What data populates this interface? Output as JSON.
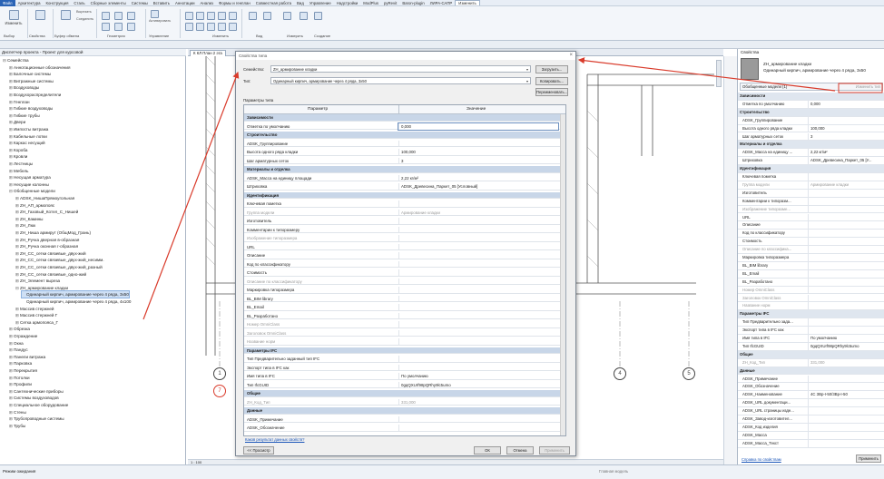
{
  "menu": [
    "Файл",
    "Архитектура",
    "Конструкция",
    "Сталь",
    "Сборные элементы",
    "Системы",
    "Вставить",
    "Аннотации",
    "Анализ",
    "Формы и генплан",
    "Совместная работа",
    "Вид",
    "Управление",
    "Надстройки",
    "ModPlus",
    "pyRevit",
    "Baron-plugin",
    "ЛИРА-САПР",
    "Изменить"
  ],
  "ribbon": {
    "modify": "Изменить",
    "select": "Выбор",
    "properties": "Свойства",
    "clipboard": "Буфер обмена",
    "cut": "Вырезать",
    "join": "Соединить",
    "geometry": "Геометрия",
    "control": "Управление",
    "edit": "Изменить",
    "view": "Вид",
    "measure": "Измерить",
    "create": "Создание",
    "activate": "Активировать"
  },
  "browser": {
    "title": "Диспетчер проекта - Проект для курсовой",
    "items": [
      {
        "t": "Семейства",
        "d": 0,
        "g": "⊟"
      },
      {
        "t": "Аннотационные обозначения",
        "d": 1,
        "g": "⊞"
      },
      {
        "t": "Балочные системы",
        "d": 1,
        "g": "⊞"
      },
      {
        "t": "Витражные системы",
        "d": 1,
        "g": "⊞"
      },
      {
        "t": "Воздуховоды",
        "d": 1,
        "g": "⊞"
      },
      {
        "t": "Воздухораспределители",
        "d": 1,
        "g": "⊞"
      },
      {
        "t": "Генплан",
        "d": 1,
        "g": "⊞"
      },
      {
        "t": "Гибкие воздуховоды",
        "d": 1,
        "g": "⊞"
      },
      {
        "t": "Гибкие трубы",
        "d": 1,
        "g": "⊞"
      },
      {
        "t": "Двери",
        "d": 1,
        "g": "⊞"
      },
      {
        "t": "Импосты витража",
        "d": 1,
        "g": "⊞"
      },
      {
        "t": "Кабельные лотки",
        "d": 1,
        "g": "⊞"
      },
      {
        "t": "Каркас несущий",
        "d": 1,
        "g": "⊞"
      },
      {
        "t": "Короба",
        "d": 1,
        "g": "⊞"
      },
      {
        "t": "Кровли",
        "d": 1,
        "g": "⊞"
      },
      {
        "t": "Лестницы",
        "d": 1,
        "g": "⊞"
      },
      {
        "t": "Мебель",
        "d": 1,
        "g": "⊞"
      },
      {
        "t": "Несущая арматура",
        "d": 1,
        "g": "⊞"
      },
      {
        "t": "Несущие колонны",
        "d": 1,
        "g": "⊞"
      },
      {
        "t": "Обобщенные модели",
        "d": 1,
        "g": "⊟"
      },
      {
        "t": "ADSK_НишаПрямоугольная",
        "d": 2,
        "g": "⊞"
      },
      {
        "t": "ZH_АП_армопояс",
        "d": 2,
        "g": "⊞"
      },
      {
        "t": "ZH_Газовый_Котел_С_Нишей",
        "d": 2,
        "g": "⊞"
      },
      {
        "t": "ZH_Камины",
        "d": 2,
        "g": "⊞"
      },
      {
        "t": "ZH_Люк",
        "d": 2,
        "g": "⊞"
      },
      {
        "t": "ZH_Ниша армирут (ОбщМод_Грань)",
        "d": 2,
        "g": "⊞"
      },
      {
        "t": "ZH_Ручка дверная в-образная",
        "d": 2,
        "g": "⊞"
      },
      {
        "t": "ZH_Ручка оконная г-образная",
        "d": 2,
        "g": "⊞"
      },
      {
        "t": "ZH_CC_сетки связевые_двух-жий",
        "d": 2,
        "g": "⊞"
      },
      {
        "t": "ZH_CC_сетки связевые_двух-жий_несимм.",
        "d": 2,
        "g": "⊞"
      },
      {
        "t": "ZH_CC_сетки связевые_двух-жий_разный",
        "d": 2,
        "g": "⊞"
      },
      {
        "t": "ZH_CC_сетки связевые_одно-жий",
        "d": 2,
        "g": "⊞"
      },
      {
        "t": "ZH_Элемент выреза",
        "d": 2,
        "g": "⊞"
      },
      {
        "t": "ZH_армирование кладки",
        "d": 2,
        "g": "⊟"
      },
      {
        "t": "Одинарный кирпич, армирование через 4 ряда, 3х50",
        "d": 3,
        "g": "",
        "sel": true
      },
      {
        "t": "Одинарный кирпич, армирование через 4 ряда, 4х100",
        "d": 3,
        "g": ""
      },
      {
        "t": "Массив стержней",
        "d": 2,
        "g": "⊞"
      },
      {
        "t": "Массив стержней Г",
        "d": 2,
        "g": "⊞"
      },
      {
        "t": "Сетка армопояса_Г",
        "d": 2,
        "g": "⊞"
      },
      {
        "t": "Обрезка",
        "d": 1,
        "g": "⊞"
      },
      {
        "t": "Ограждение",
        "d": 1,
        "g": "⊞"
      },
      {
        "t": "Окна",
        "d": 1,
        "g": "⊞"
      },
      {
        "t": "Пандус",
        "d": 1,
        "g": "⊞"
      },
      {
        "t": "Панели витража",
        "d": 1,
        "g": "⊞"
      },
      {
        "t": "Парковка",
        "d": 1,
        "g": "⊞"
      },
      {
        "t": "Перекрытия",
        "d": 1,
        "g": "⊞"
      },
      {
        "t": "Потолки",
        "d": 1,
        "g": "⊞"
      },
      {
        "t": "Профили",
        "d": 1,
        "g": "⊞"
      },
      {
        "t": "Сантехнические приборы",
        "d": 1,
        "g": "⊞"
      },
      {
        "t": "Системы воздуховодов",
        "d": 1,
        "g": "⊞"
      },
      {
        "t": "Специальное оборудование",
        "d": 1,
        "g": "⊞"
      },
      {
        "t": "Стены",
        "d": 1,
        "g": "⊞"
      },
      {
        "t": "Трубопроводные системы",
        "d": 1,
        "g": "⊞"
      },
      {
        "t": "Трубы",
        "d": 1,
        "g": "⊞"
      }
    ]
  },
  "view_tab": "К КЛ План 2 эта",
  "grid_bubbles": [
    "1",
    "7",
    "4",
    "5"
  ],
  "properties": {
    "title": "Свойства",
    "family": "ZH_армирование кладки",
    "type": "Одинарный кирпич, армирование через 4 ряда, 3х50",
    "filter": "Обобщенные модели (1)",
    "edit_type": "Изменить тип",
    "help": "Справка по свойствам",
    "apply": "Применить",
    "rows": [
      {
        "k": "Зависимости",
        "c": 1
      },
      {
        "k": "Отметка по умолчанию",
        "v": "0,000"
      },
      {
        "k": "Строительство",
        "c": 1
      },
      {
        "k": "ADSK_Группирование",
        "v": ""
      },
      {
        "k": "Высота одного ряда кладки",
        "v": "100,000"
      },
      {
        "k": "Шаг арматурных сеток",
        "v": "3"
      },
      {
        "k": "Материалы и отделка",
        "c": 1
      },
      {
        "k": "ADSK_Масса на единицу ...",
        "v": "2,22 кг/м²"
      },
      {
        "k": "Штриховка",
        "v": "ADSK_Древесина_Паркет_05 [У..."
      },
      {
        "k": "Идентификация",
        "c": 1
      },
      {
        "k": "Ключевая пометка",
        "v": ""
      },
      {
        "k": "Группа модели",
        "v": "Армирование кладки",
        "g": 1
      },
      {
        "k": "Изготовитель",
        "v": ""
      },
      {
        "k": "Комментарии к типоразм...",
        "v": ""
      },
      {
        "k": "Изображение типоразме...",
        "v": "",
        "g": 1
      },
      {
        "k": "URL",
        "v": ""
      },
      {
        "k": "Описание",
        "v": ""
      },
      {
        "k": "Код по классификатору",
        "v": ""
      },
      {
        "k": "Стоимость",
        "v": ""
      },
      {
        "k": "Описание по классифика...",
        "v": "",
        "g": 1
      },
      {
        "k": "Маркировка типоразмера",
        "v": ""
      },
      {
        "k": "BL_BIM library",
        "v": ""
      },
      {
        "k": "BL_Email",
        "v": ""
      },
      {
        "k": "BL_Разработано",
        "v": ""
      },
      {
        "k": "Номер OmniClass",
        "v": "",
        "g": 1
      },
      {
        "k": "Заголовок OmniClass",
        "v": "",
        "g": 1
      },
      {
        "k": "Название норм",
        "v": "",
        "g": 1
      },
      {
        "k": "Параметры IFC",
        "c": 1
      },
      {
        "k": "Тип Предварительно зада...",
        "v": ""
      },
      {
        "k": "Экспорт типа в IFC как",
        "v": ""
      },
      {
        "k": "Имя типа в IFC",
        "v": "По умолчанию"
      },
      {
        "k": "Тип IfcGUID",
        "v": "0gqQXUrf98pQRhy9lc5umo"
      },
      {
        "k": "Общие",
        "c": 1
      },
      {
        "k": "ZH_Код_Тип",
        "v": "331,000",
        "g": 1
      },
      {
        "k": "Данные",
        "c": 1
      },
      {
        "k": "ADSK_Примечание",
        "v": ""
      },
      {
        "k": "ADSK_Обозначение",
        "v": ""
      },
      {
        "k": "ADSK_Наименование",
        "v": "4С 3Вр-I-50/3Вр-I-50"
      },
      {
        "k": "ADSK_URL документаци...",
        "v": ""
      },
      {
        "k": "ADSK_URL страницы изде...",
        "v": ""
      },
      {
        "k": "ADSK_Завод-изготовител...",
        "v": ""
      },
      {
        "k": "ADSK_Код изделия",
        "v": ""
      },
      {
        "k": "ADSK_Масса",
        "v": ""
      },
      {
        "k": "ADSK_Масса_Текст",
        "v": ""
      }
    ]
  },
  "dialog": {
    "title": "Свойства типа",
    "family_label": "Семейство:",
    "family_value": "ZH_армирование кладки",
    "type_label": "Тип:",
    "type_value": "Одинарный кирпич, армирование через 4 ряда, 3х50",
    "load": "Загрузить...",
    "duplicate": "Копировать...",
    "rename": "Переименовать...",
    "params_label": "Параметры типа",
    "col_param": "Параметр",
    "col_value": "Значение",
    "link": "Каков результат данных свойств?",
    "preview": "<< Просмотр",
    "ok": "ОК",
    "cancel": "Отмена",
    "apply": "Применить",
    "rows": [
      {
        "k": "Зависимости",
        "c": 1
      },
      {
        "k": "Отметка по умолчанию",
        "v": "0,000",
        "e": 1
      },
      {
        "k": "Строительство",
        "c": 1
      },
      {
        "k": "ADSK_Группирование",
        "v": ""
      },
      {
        "k": "Высота одного ряда кладки",
        "v": "100,000"
      },
      {
        "k": "Шаг арматурных сеток",
        "v": "3"
      },
      {
        "k": "Материалы и отделка",
        "c": 1
      },
      {
        "k": "ADSK_Масса на единицу площади",
        "v": "2,22 кг/м²"
      },
      {
        "k": "Штриховка",
        "v": "ADSK_Древесина_Паркет_05 [Условный]"
      },
      {
        "k": "Идентификация",
        "c": 1
      },
      {
        "k": "Ключевая пометка",
        "v": ""
      },
      {
        "k": "Группа модели",
        "v": "Армирование кладки",
        "g": 1
      },
      {
        "k": "Изготовитель",
        "v": ""
      },
      {
        "k": "Комментарии к типоразмеру",
        "v": ""
      },
      {
        "k": "Изображение типоразмера",
        "v": "",
        "g": 1
      },
      {
        "k": "URL",
        "v": ""
      },
      {
        "k": "Описание",
        "v": ""
      },
      {
        "k": "Код по классификатору",
        "v": ""
      },
      {
        "k": "Стоимость",
        "v": ""
      },
      {
        "k": "Описание по классификатору",
        "v": "",
        "g": 1
      },
      {
        "k": "Маркировка типоразмера",
        "v": ""
      },
      {
        "k": "BL_BIM library",
        "v": ""
      },
      {
        "k": "BL_Email",
        "v": ""
      },
      {
        "k": "BL_Разработано",
        "v": ""
      },
      {
        "k": "Номер OmniClass",
        "v": "",
        "g": 1
      },
      {
        "k": "Заголовок OmniClass",
        "v": "",
        "g": 1
      },
      {
        "k": "Название норм",
        "v": "",
        "g": 1
      },
      {
        "k": "Параметры IFC",
        "c": 1
      },
      {
        "k": "Тип Предварительно заданный тип IFC",
        "v": ""
      },
      {
        "k": "Экспорт типа в IFC как",
        "v": ""
      },
      {
        "k": "Имя типа в IFC",
        "v": "По умолчанию"
      },
      {
        "k": "Тип IfcGUID",
        "v": "0gqQXUrf98pQRhy9lc5umo"
      },
      {
        "k": "Общие",
        "c": 1
      },
      {
        "k": "ZH_Код_Тип",
        "v": "331,000",
        "g": 1
      },
      {
        "k": "Данные",
        "c": 1
      },
      {
        "k": "ADSK_Примечание",
        "v": ""
      },
      {
        "k": "ADSK_Обозначение",
        "v": ""
      }
    ]
  },
  "status": {
    "left": "Режим ожидания",
    "scale": "1 : 100",
    "search": "Главная модель"
  }
}
